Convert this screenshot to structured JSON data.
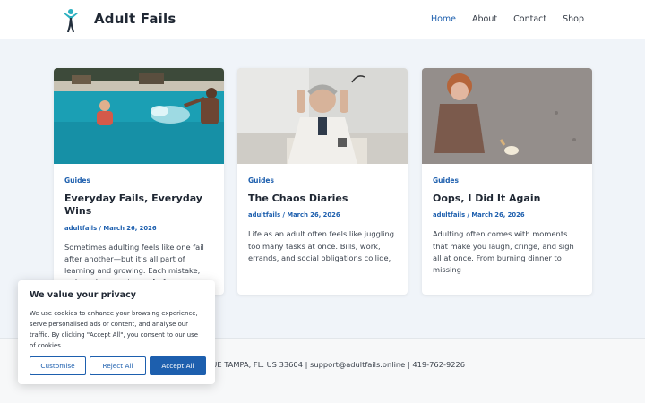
{
  "site": {
    "title": "Adult Fails",
    "logo_icon": "leaping-figure-logo"
  },
  "nav": [
    {
      "label": "Home",
      "active": true
    },
    {
      "label": "About",
      "active": false
    },
    {
      "label": "Contact",
      "active": false
    },
    {
      "label": "Shop",
      "active": false
    }
  ],
  "posts": [
    {
      "category": "Guides",
      "title": "Everyday Fails, Everyday Wins",
      "meta": "adultfails / March 26, 2026",
      "excerpt": "Sometimes adulting feels like one fail after another—but it’s all part of learning and growing. Each mistake, awkward encounter, or […]",
      "image": "pool-splash-photo"
    },
    {
      "category": "Guides",
      "title": "The Chaos Diaries",
      "meta": "adultfails / March 26, 2026",
      "excerpt": "Life as an adult often feels like juggling too many tasks at once. Bills, work, errands, and social obligations collide,",
      "image": "stressed-man-photo"
    },
    {
      "category": "Guides",
      "title": "Oops, I Did It Again",
      "meta": "adultfails / March 26, 2026",
      "excerpt": "Adulting often comes with moments that make you laugh, cringe, and sigh all at once. From burning dinner to missing",
      "image": "dropped-ice-cream-photo"
    }
  ],
  "footer": {
    "text": "EE AVENUE TAMPA, FL. US 33604 | support@adultfails.online | 419-762-9226"
  },
  "cookie": {
    "title": "We value your privacy",
    "text": "We use cookies to enhance your browsing experience, serve personalised ads or content, and analyse our traffic. By clicking \"Accept All\", you consent to our use of cookies.",
    "customise": "Customise",
    "reject": "Reject All",
    "accept": "Accept All"
  },
  "colors": {
    "accent": "#1d5fae",
    "background": "#f0f4f9"
  }
}
